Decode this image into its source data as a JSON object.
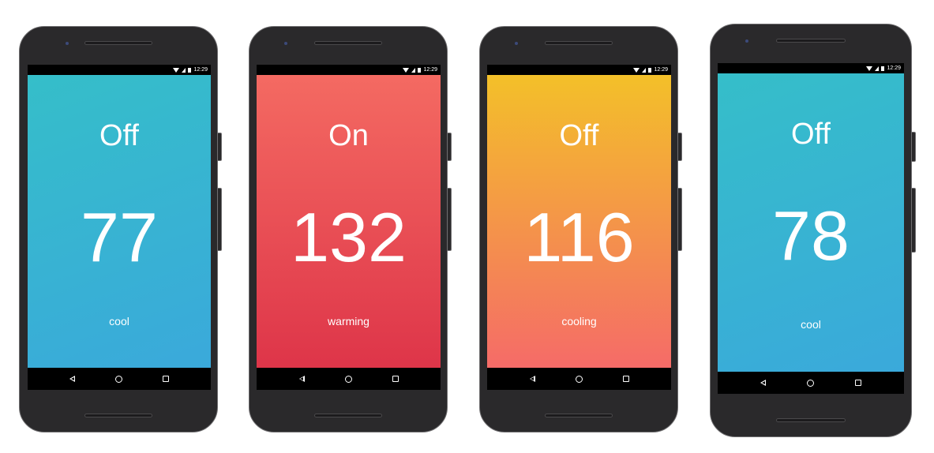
{
  "status_bar": {
    "time": "12:29"
  },
  "phones": [
    {
      "mode": "Off",
      "temperature": "77",
      "state": "cool",
      "gradient": [
        "#35bec9",
        "#3aa9db"
      ]
    },
    {
      "mode": "On",
      "temperature": "132",
      "state": "warming",
      "gradient": [
        "#f46a62",
        "#de3549"
      ]
    },
    {
      "mode": "Off",
      "temperature": "116",
      "state": "cooling",
      "gradient": [
        "#f3c029",
        "#f56b68"
      ]
    },
    {
      "mode": "Off",
      "temperature": "78",
      "state": "cool",
      "gradient": [
        "#35bec9",
        "#3aa9db"
      ]
    }
  ],
  "nav_icons": [
    "back-icon",
    "home-icon",
    "recents-icon"
  ]
}
